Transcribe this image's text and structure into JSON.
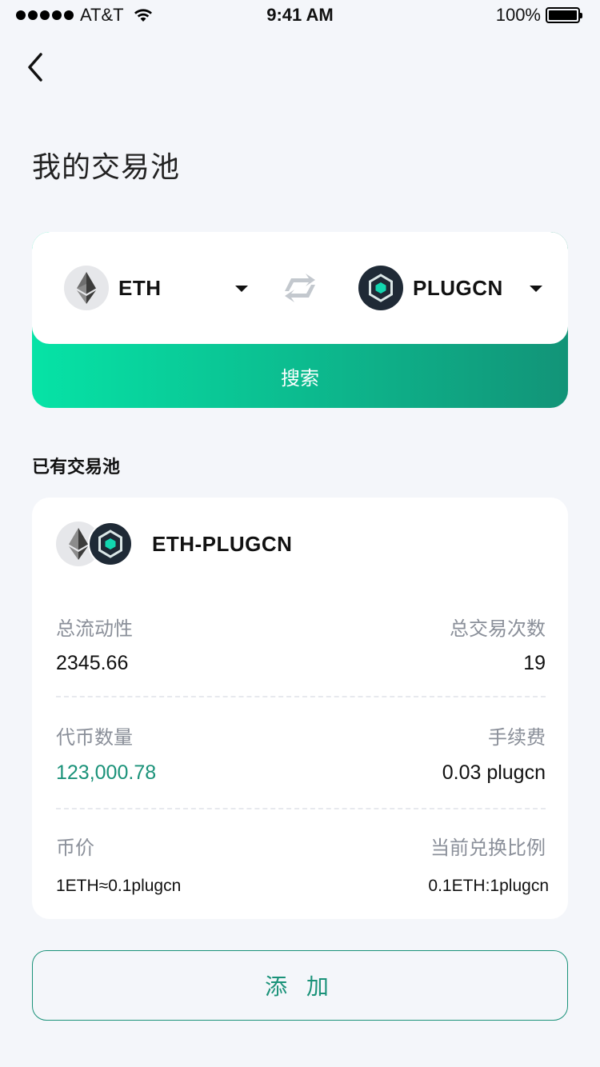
{
  "status_bar": {
    "carrier": "AT&T",
    "time": "9:41 AM",
    "battery": "100%"
  },
  "page": {
    "title": "我的交易池"
  },
  "selector": {
    "from_token": "ETH",
    "to_token": "PLUGCN",
    "search_label": "搜索"
  },
  "pools_section": {
    "title": "已有交易池"
  },
  "pool": {
    "pair_name": "ETH-PLUGCN",
    "total_liquidity_label": "总流动性",
    "total_liquidity_value": "2345.66",
    "total_trades_label": "总交易次数",
    "total_trades_value": "19",
    "token_amount_label": "代币数量",
    "token_amount_value": "123,000.78",
    "fee_label": "手续费",
    "fee_value": "0.03 plugcn",
    "price_label": "币价",
    "price_value": "1ETH≈0.1plugcn",
    "ratio_label": "当前兑换比例",
    "ratio_value": "0.1ETH:1plugcn"
  },
  "actions": {
    "add_label": "添 加"
  },
  "colors": {
    "accent": "#1a9279",
    "gradient_start": "#06e3a6",
    "gradient_end": "#129478",
    "background": "#f4f6fa"
  },
  "icons": {
    "back": "chevron-left-icon",
    "eth": "ethereum-icon",
    "plugcn": "plugcn-hex-icon",
    "swap": "swap-arrows-icon",
    "dropdown": "caret-down-icon"
  }
}
